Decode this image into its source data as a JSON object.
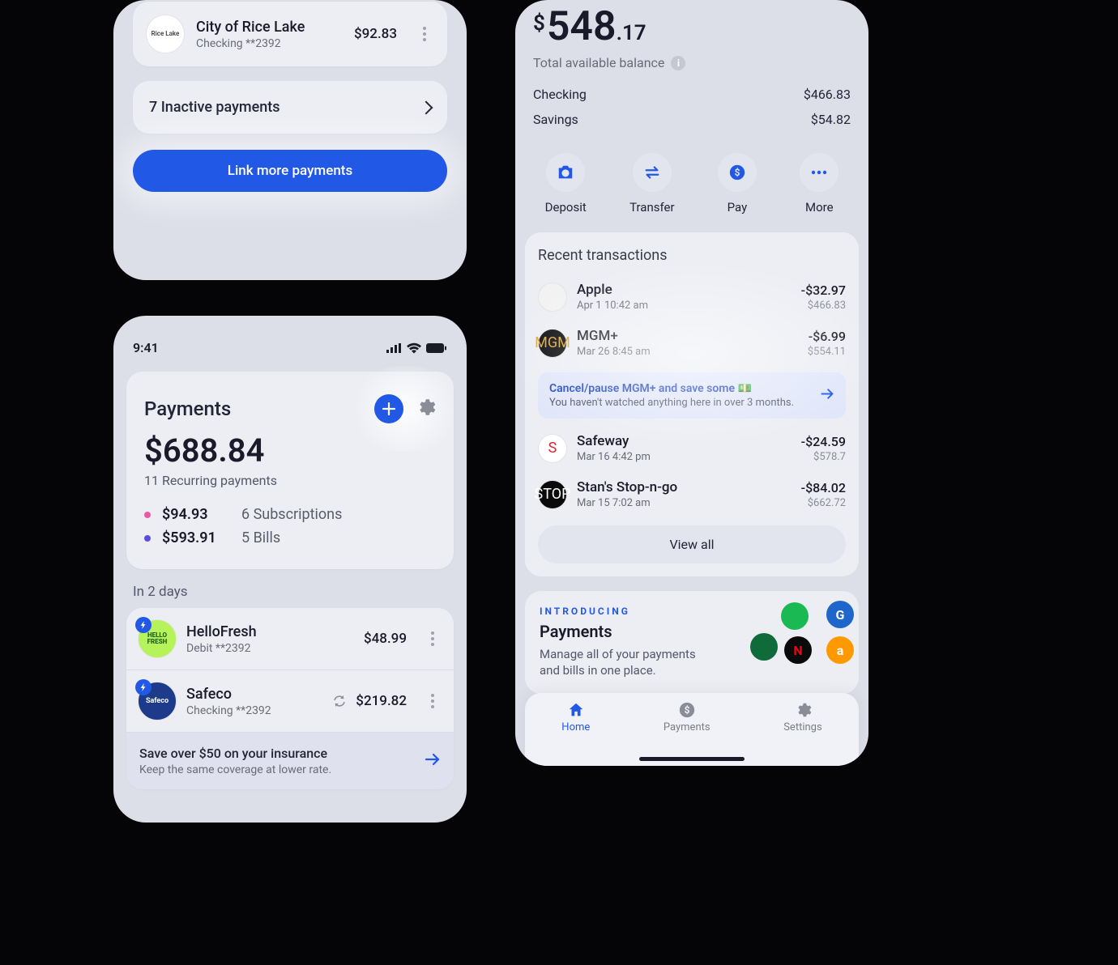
{
  "phoneA": {
    "row": {
      "name": "City of Rice Lake",
      "sub": "Checking  **2392",
      "amount": "$92.83",
      "logo_text": "Rice Lake"
    },
    "inactive_label": "7 Inactive payments",
    "link_button": "Link more payments"
  },
  "phoneB": {
    "time": "9:41",
    "title": "Payments",
    "total": "$688.84",
    "total_sub": "11 Recurring payments",
    "breakdown": [
      {
        "color": "#e85aa6",
        "value": "$94.93",
        "label": "6 Subscriptions"
      },
      {
        "color": "#5a4ddc",
        "value": "$593.91",
        "label": "5 Bills"
      }
    ],
    "section": "In 2 days",
    "items": [
      {
        "name": "HelloFresh",
        "sub": "Debit  **2392",
        "amount": "$48.99",
        "avatar_bg": "#b6f25a",
        "avatar_text": "HELLO FRESH",
        "avatar_text_color": "#1a5a1a"
      },
      {
        "name": "Safeco",
        "sub": "Checking  **2392",
        "amount": "$219.82",
        "avatar_bg": "#1d3b8a",
        "avatar_text": "Safeco",
        "avatar_text_color": "#fff",
        "sync": true
      }
    ],
    "suggest": {
      "title": "Save over $50 on your insurance",
      "sub": "Keep the same coverage at lower rate."
    }
  },
  "phoneC": {
    "balance_whole": "548",
    "balance_cents": ".17",
    "balance_label": "Total available balance",
    "accounts": [
      {
        "name": "Checking",
        "amount": "$466.83"
      },
      {
        "name": "Savings",
        "amount": "$54.82"
      }
    ],
    "actions": [
      {
        "icon": "camera",
        "label": "Deposit"
      },
      {
        "icon": "transfer",
        "label": "Transfer"
      },
      {
        "icon": "pay",
        "label": "Pay"
      },
      {
        "icon": "more",
        "label": "More"
      }
    ],
    "tx_title": "Recent transactions",
    "tx": [
      {
        "name": "Apple",
        "time": "Apr 1 10:42 am",
        "amount": "-$32.97",
        "bal": "$466.83",
        "avatar_bg": "#f2f2f2",
        "avatar_text": ""
      },
      {
        "name": "MGM+",
        "time": "Mar 26 8:45 am",
        "amount": "-$6.99",
        "bal": "$554.11",
        "avatar_bg": "#0a0a0a",
        "avatar_text": "MGM",
        "avatar_text_color": "#d9a441"
      },
      {
        "name": "Safeway",
        "time": "Mar 16 4:42 pm",
        "amount": "-$24.59",
        "bal": "$578.7",
        "avatar_bg": "#fff",
        "avatar_text": "S",
        "avatar_text_color": "#d8232a"
      },
      {
        "name": "Stan's Stop-n-go",
        "time": "Mar 15 7:02 am",
        "amount": "-$84.02",
        "bal": "$662.72",
        "avatar_bg": "#0a0a0a",
        "avatar_text": "STOP",
        "avatar_text_color": "#fff"
      }
    ],
    "tx_suggest": {
      "title": "Cancel/pause MGM+ and save some 💵",
      "sub": "You haven't watched anything here in over 3 months."
    },
    "view_all": "View all",
    "promo": {
      "tag": "INTRODUCING",
      "title": "Payments",
      "sub": "Manage all of your payments and bills in one place."
    },
    "tabs": [
      {
        "icon": "home",
        "label": "Home",
        "active": true
      },
      {
        "icon": "pay",
        "label": "Payments",
        "active": false
      },
      {
        "icon": "gear",
        "label": "Settings",
        "active": false
      }
    ]
  }
}
